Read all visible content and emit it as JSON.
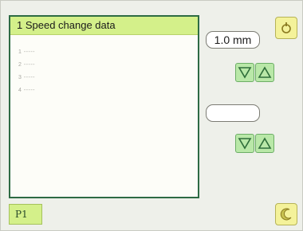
{
  "list": {
    "header": "1 Speed change data",
    "rows": [
      "1 -----",
      "2 -----",
      "3 -----",
      "4 -----"
    ]
  },
  "controls": {
    "pitch_value": "1.0 mm",
    "speed_value": ""
  },
  "page": {
    "label": "P1"
  },
  "icons": {
    "top_corner": "return-icon",
    "bottom_corner": "moon-icon",
    "down": "triangle-down-icon",
    "up": "triangle-up-icon"
  },
  "colors": {
    "header_bg": "#d4f08a",
    "panel_border": "#2e6b44",
    "step_bg": "#b9e8a8",
    "corner_bg": "#f4f29a"
  }
}
